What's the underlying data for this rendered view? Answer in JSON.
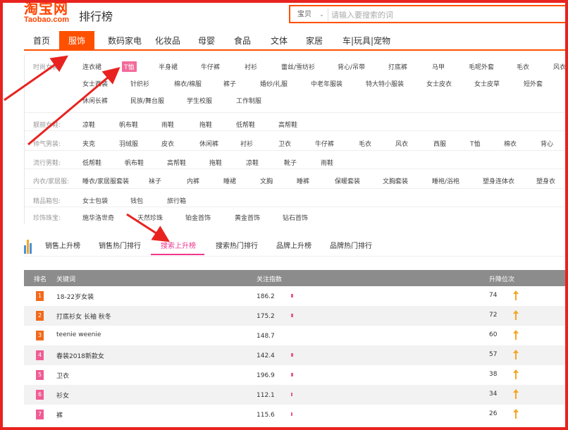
{
  "header": {
    "logo_cn": "淘宝网",
    "logo_en": "Taobao.com",
    "title": "排行榜",
    "search_scope": "宝贝",
    "search_placeholder": "请输入要搜索的词"
  },
  "nav": {
    "items": [
      {
        "label": "首页"
      },
      {
        "label": "服饰",
        "active": true
      },
      {
        "label": "数码家电"
      },
      {
        "label": "化妆品"
      },
      {
        "label": "母婴"
      },
      {
        "label": "食品"
      },
      {
        "label": "文体"
      },
      {
        "label": "家居"
      },
      {
        "label": "车|玩具|宠物"
      }
    ]
  },
  "categories": {
    "rows": [
      {
        "label": "时尚女装:",
        "lines": [
          [
            "连衣裙",
            "T恤",
            "半身裙",
            "牛仔裤",
            "衬衫",
            "蕾丝/雪纺衫",
            "背心/吊带",
            "打底裤",
            "马甲",
            "毛呢外套",
            "毛衣",
            "风衣"
          ],
          [
            "女士西装",
            "针织衫",
            "棉衣/棉服",
            "裤子",
            "婚纱/礼服",
            "中老年服装",
            "特大特小服装",
            "女士皮衣",
            "女士皮草",
            "短外套"
          ],
          [
            "休闲长裤",
            "民族/舞台服",
            "学生校服",
            "工作制服"
          ]
        ]
      },
      {
        "label": "靓丽女鞋:",
        "lines": [
          [
            "凉鞋",
            "帆布鞋",
            "雨鞋",
            "拖鞋",
            "低帮鞋",
            "高帮鞋"
          ]
        ]
      },
      {
        "label": "帅气男装:",
        "lines": [
          [
            "夹克",
            "羽绒服",
            "皮衣",
            "休闲裤",
            "衬衫",
            "卫衣",
            "牛仔裤",
            "毛衣",
            "风衣",
            "西服",
            "T恤",
            "棉衣",
            "背心"
          ]
        ]
      },
      {
        "label": "流行男鞋:",
        "lines": [
          [
            "低帮鞋",
            "帆布鞋",
            "高帮鞋",
            "拖鞋",
            "凉鞋",
            "靴子",
            "雨鞋"
          ]
        ]
      },
      {
        "label": "内衣/家居服:",
        "lines": [
          [
            "睡衣/家居服套装",
            "袜子",
            "内裤",
            "睡裙",
            "文胸",
            "睡裤",
            "保暖套装",
            "文胸套装",
            "睡袍/浴袍",
            "塑身连体衣",
            "塑身衣"
          ]
        ]
      },
      {
        "label": "精品箱包:",
        "lines": [
          [
            "女士包袋",
            "钱包",
            "旅行箱"
          ]
        ]
      },
      {
        "label": "珍饰珠宝:",
        "lines": [
          [
            "施华洛世奇",
            "天然珍珠",
            "铂金首饰",
            "黄金首饰",
            "钻石首饰"
          ]
        ]
      }
    ]
  },
  "tabs": [
    {
      "label": "销售上升榜"
    },
    {
      "label": "销售热门排行"
    },
    {
      "label": "搜索上升榜",
      "active": true
    },
    {
      "label": "搜索热门排行"
    },
    {
      "label": "品牌上升榜"
    },
    {
      "label": "品牌热门排行"
    }
  ],
  "table": {
    "headers": {
      "rank": "排名",
      "keyword": "关键词",
      "index": "关注指数",
      "change": "升降位次"
    },
    "rows": [
      {
        "rank": "1",
        "keyword": "18-22岁女装",
        "index": "186.2",
        "change": "74"
      },
      {
        "rank": "2",
        "keyword": "打底衫女 长袖 秋冬",
        "index": "175.2",
        "change": "72"
      },
      {
        "rank": "3",
        "keyword": "teenie weenie",
        "index": "148.7",
        "change": "60"
      },
      {
        "rank": "4",
        "keyword": "春装2018新款女",
        "index": "142.4",
        "change": "57"
      },
      {
        "rank": "5",
        "keyword": "卫衣",
        "index": "196.9",
        "change": "38"
      },
      {
        "rank": "6",
        "keyword": "衫女",
        "index": "112.1",
        "change": "34"
      },
      {
        "rank": "7",
        "keyword": "裤",
        "index": "115.6",
        "change": "26"
      }
    ]
  },
  "colors": {
    "brand": "#ff5000",
    "accent_pink": "#f0368c",
    "highlight_tag": "#f26b9b",
    "rank_top": "#f26a1b",
    "rank_mid": "#f05c93",
    "annotation_red": "#e8231f",
    "arrow_up": "#f5a623"
  },
  "icons": {
    "tab_icon": "bar-chart-icon",
    "change_icon": "arrow-up-icon"
  }
}
